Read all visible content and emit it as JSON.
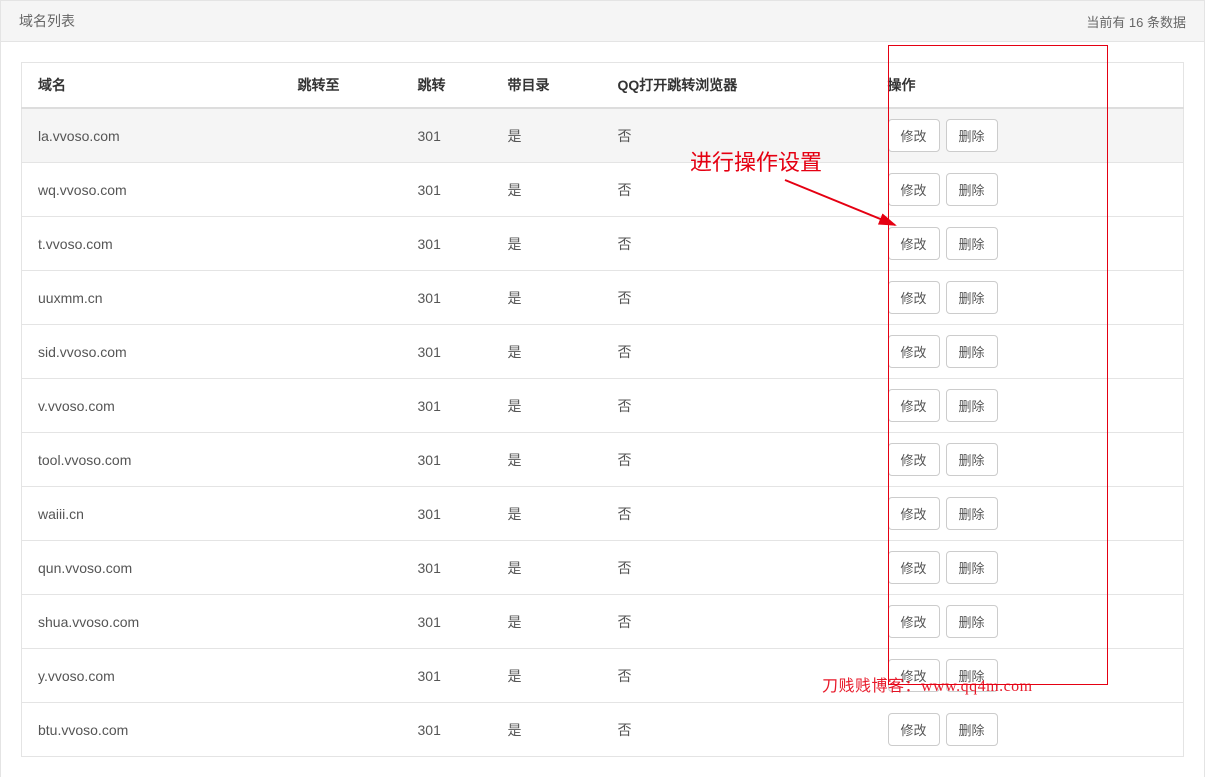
{
  "header": {
    "title": "域名列表",
    "count_text": "当前有 16 条数据"
  },
  "table": {
    "columns": {
      "domain": "域名",
      "redirect_to": "跳转至",
      "redirect": "跳转",
      "with_dir": "带目录",
      "qq_browser": "QQ打开跳转浏览器",
      "action": "操作"
    },
    "action_labels": {
      "edit": "修改",
      "delete": "删除"
    },
    "rows": [
      {
        "domain": "la.vvoso.com",
        "redirect_to": "",
        "redirect": "301",
        "with_dir": "是",
        "qq_browser": "否"
      },
      {
        "domain": "wq.vvoso.com",
        "redirect_to": "",
        "redirect": "301",
        "with_dir": "是",
        "qq_browser": "否"
      },
      {
        "domain": "t.vvoso.com",
        "redirect_to": "",
        "redirect": "301",
        "with_dir": "是",
        "qq_browser": "否"
      },
      {
        "domain": "uuxmm.cn",
        "redirect_to": "",
        "redirect": "301",
        "with_dir": "是",
        "qq_browser": "否"
      },
      {
        "domain": "sid.vvoso.com",
        "redirect_to": "",
        "redirect": "301",
        "with_dir": "是",
        "qq_browser": "否"
      },
      {
        "domain": "v.vvoso.com",
        "redirect_to": "",
        "redirect": "301",
        "with_dir": "是",
        "qq_browser": "否"
      },
      {
        "domain": "tool.vvoso.com",
        "redirect_to": "",
        "redirect": "301",
        "with_dir": "是",
        "qq_browser": "否"
      },
      {
        "domain": "waiii.cn",
        "redirect_to": "",
        "redirect": "301",
        "with_dir": "是",
        "qq_browser": "否"
      },
      {
        "domain": "qun.vvoso.com",
        "redirect_to": "",
        "redirect": "301",
        "with_dir": "是",
        "qq_browser": "否"
      },
      {
        "domain": "shua.vvoso.com",
        "redirect_to": "",
        "redirect": "301",
        "with_dir": "是",
        "qq_browser": "否"
      },
      {
        "domain": "y.vvoso.com",
        "redirect_to": "",
        "redirect": "301",
        "with_dir": "是",
        "qq_browser": "否"
      },
      {
        "domain": "btu.vvoso.com",
        "redirect_to": "",
        "redirect": "301",
        "with_dir": "是",
        "qq_browser": "否"
      }
    ]
  },
  "annotation": {
    "label": "进行操作设置",
    "watermark": "刀贱贱博客：www.qq4m.com"
  }
}
